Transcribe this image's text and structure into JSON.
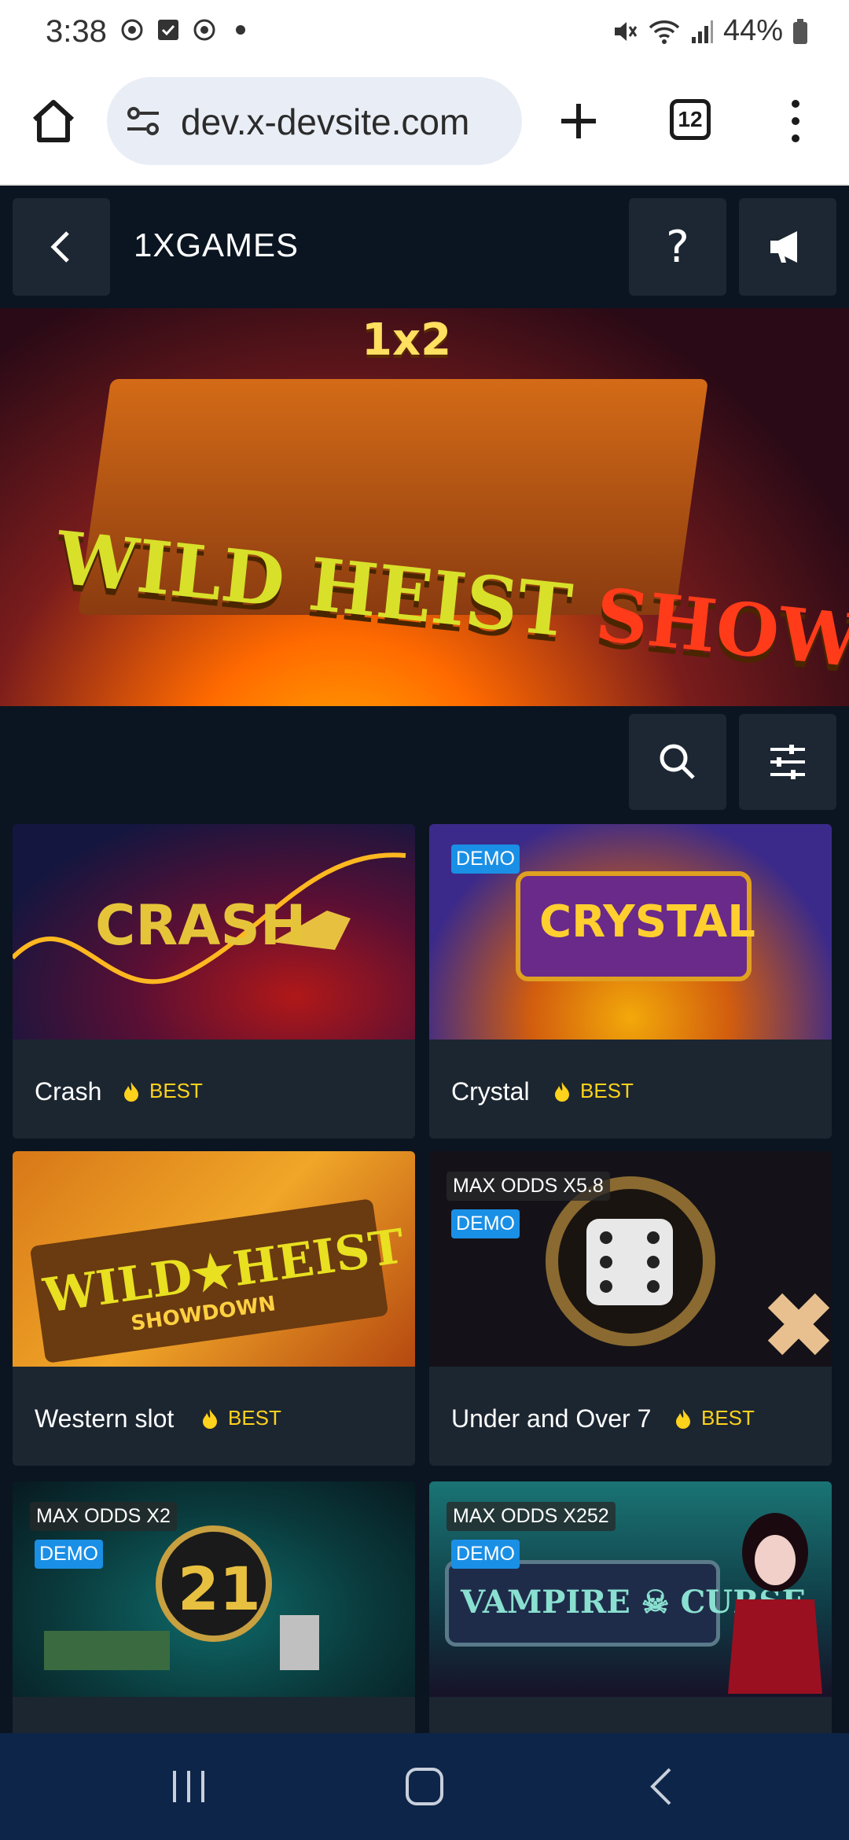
{
  "status_bar": {
    "time": "3:38",
    "battery": "44%"
  },
  "browser": {
    "url": "dev.x-devsite.com",
    "tab_count": "12"
  },
  "header": {
    "title": "1XGAMES"
  },
  "banner": {
    "title_left": "WILD HEIST",
    "title_right": "SHOWDOWN",
    "top_text": "1x2"
  },
  "games": [
    {
      "name": "Crash",
      "badge": "BEST",
      "art_text": "CRASH"
    },
    {
      "name": "Crystal",
      "badge": "BEST",
      "demo": "DEMO",
      "art_text": "CRYSTAL"
    },
    {
      "name": "Western slot",
      "badge": "BEST",
      "art_text": "WILD★HEIST",
      "art_sub": "SHOWDOWN"
    },
    {
      "name": "Under and Over 7",
      "badge": "BEST",
      "demo": "DEMO",
      "max_odds": "MAX ODDS X5.8"
    },
    {
      "name": "",
      "demo": "DEMO",
      "max_odds": "MAX ODDS X2",
      "art_text": "21"
    },
    {
      "name": "",
      "demo": "DEMO",
      "max_odds": "MAX ODDS X252",
      "art_text": "VAMPIRE ☠ CURSE"
    }
  ],
  "colors": {
    "accent_demo": "#1a8fe6",
    "best": "#ffd21c",
    "page_bg": "#0b1521",
    "card_bg": "#1c2631"
  },
  "icons": [
    "home-icon",
    "tune-icon",
    "plus-icon",
    "tabs-icon",
    "more-vert-icon",
    "back-icon",
    "help-icon",
    "megaphone-icon",
    "search-icon",
    "filter-icon",
    "fire-icon",
    "recents-icon",
    "home-nav-icon",
    "back-nav-icon"
  ]
}
